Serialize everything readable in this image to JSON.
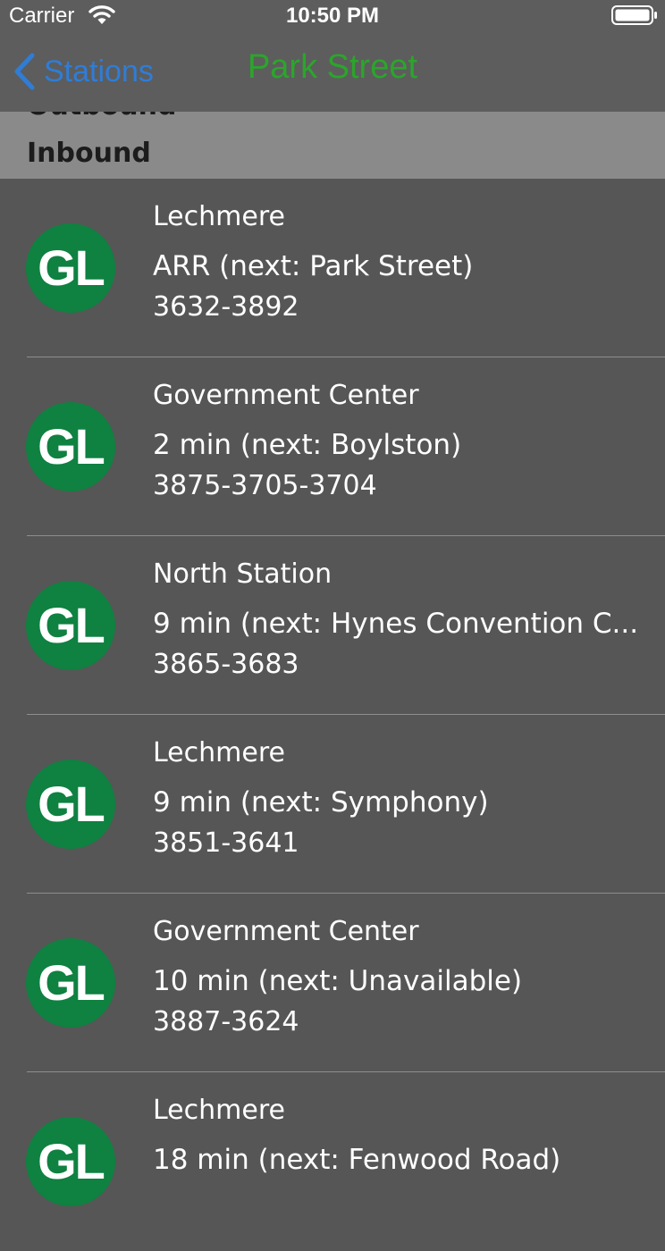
{
  "status_bar": {
    "carrier": "Carrier",
    "time": "10:50 PM"
  },
  "nav": {
    "back_label": "Stations",
    "title": "Park Street",
    "colors": {
      "back": "#2f7dd7",
      "title": "#2ba52b"
    }
  },
  "segments": {
    "options": [
      "Outbound",
      "Inbound"
    ],
    "selected": "Inbound"
  },
  "trains": [
    {
      "line": "GL",
      "destination": "Lechmere",
      "eta": "ARR (next: Park Street)",
      "cars": "3632-3892"
    },
    {
      "line": "GL",
      "destination": "Government Center",
      "eta": "2 min (next: Boylston)",
      "cars": "3875-3705-3704"
    },
    {
      "line": "GL",
      "destination": "North Station",
      "eta": "9 min (next: Hynes Convention C...",
      "cars": "3865-3683"
    },
    {
      "line": "GL",
      "destination": "Lechmere",
      "eta": "9 min (next: Symphony)",
      "cars": "3851-3641"
    },
    {
      "line": "GL",
      "destination": "Government Center",
      "eta": "10 min (next: Unavailable)",
      "cars": "3887-3624"
    },
    {
      "line": "GL",
      "destination": "Lechmere",
      "eta": "18 min (next: Fenwood Road)",
      "cars": ""
    }
  ],
  "line_color": "#0f8140"
}
